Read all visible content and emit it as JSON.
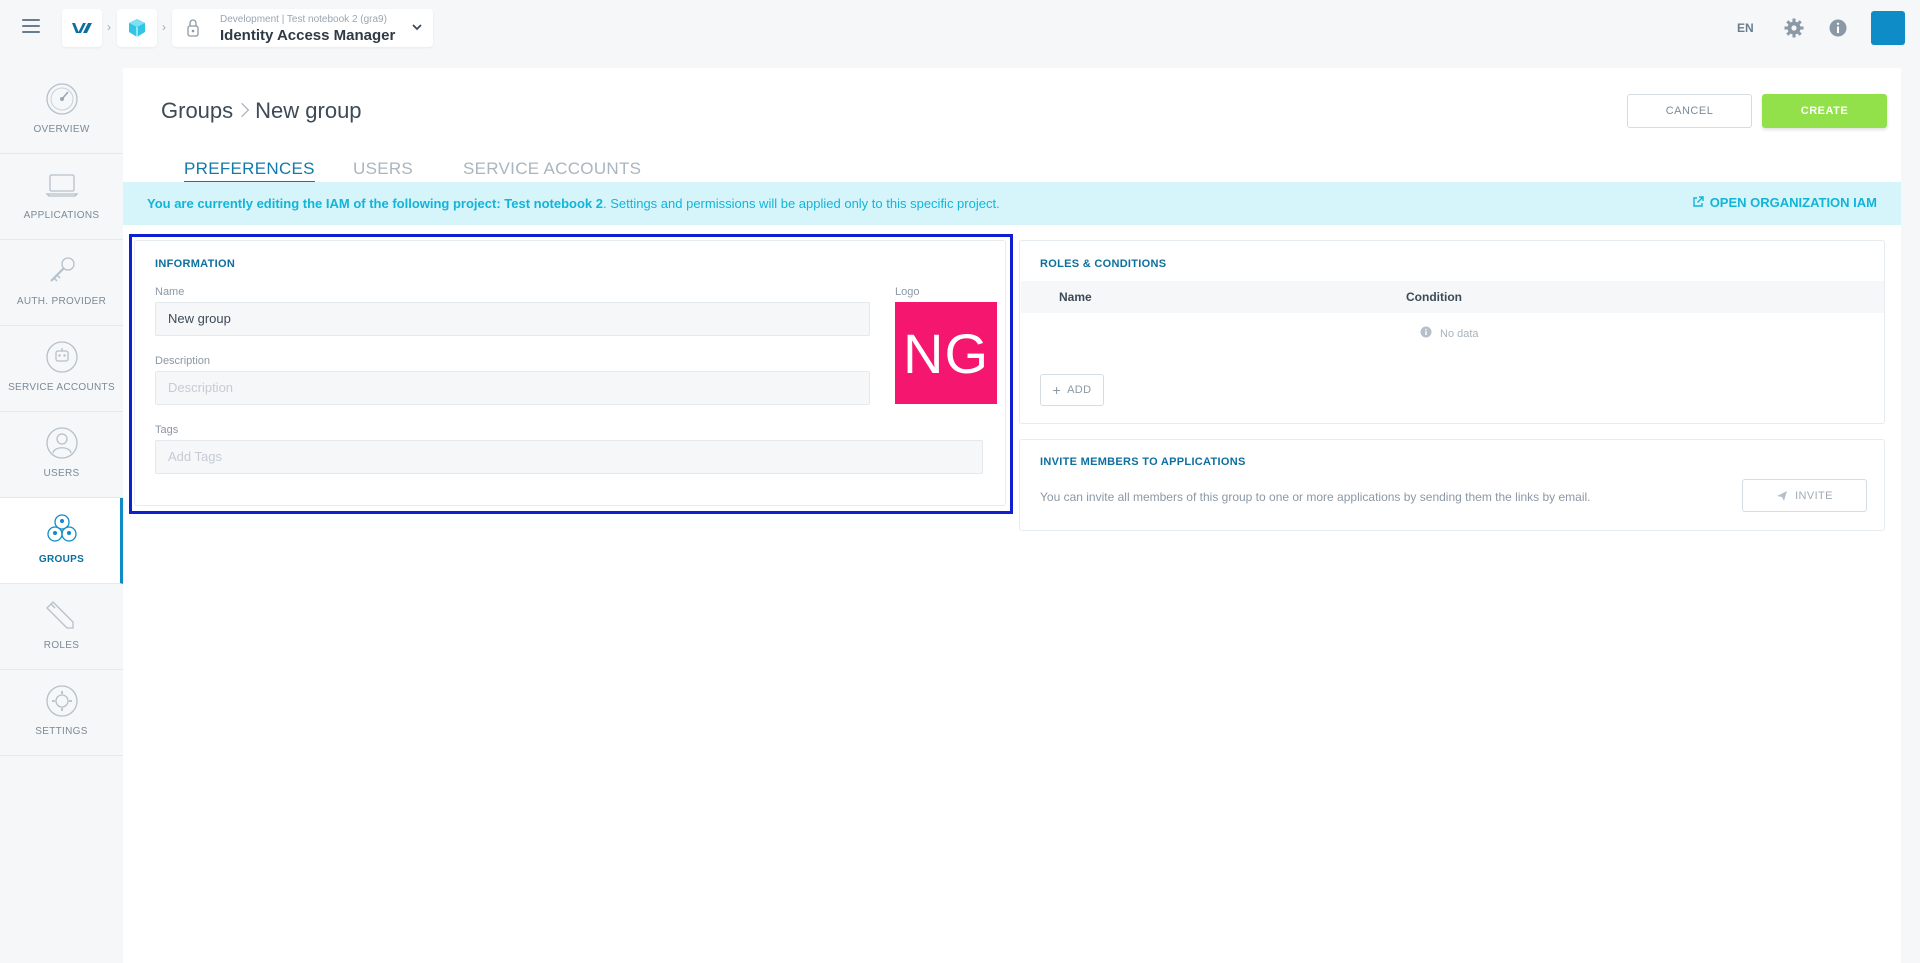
{
  "topbar": {
    "project_path": "Development | Test notebook 2 (gra9)",
    "app_title": "Identity Access Manager",
    "language": "EN",
    "icons": [
      "menu-icon",
      "ovh-logo-icon",
      "cube-icon",
      "hand-lock-icon",
      "chevron-down-icon",
      "gear-icon",
      "info-icon"
    ]
  },
  "sidenav": {
    "items": [
      {
        "label": "OVERVIEW",
        "icon": "gauge-icon",
        "active": false
      },
      {
        "label": "APPLICATIONS",
        "icon": "laptop-icon",
        "active": false
      },
      {
        "label": "AUTH. PROVIDER",
        "icon": "key-icon",
        "active": false
      },
      {
        "label": "SERVICE ACCOUNTS",
        "icon": "robot-icon",
        "active": false
      },
      {
        "label": "USERS",
        "icon": "user-icon",
        "active": false
      },
      {
        "label": "GROUPS",
        "icon": "group-icon",
        "active": true
      },
      {
        "label": "ROLES",
        "icon": "pencil-icon",
        "active": false
      },
      {
        "label": "SETTINGS",
        "icon": "settings-icon",
        "active": false
      }
    ]
  },
  "header": {
    "breadcrumb_parent": "Groups",
    "breadcrumb_current": "New group",
    "cancel_label": "CANCEL",
    "create_label": "CREATE",
    "accent_color": "#92e04a"
  },
  "tabs": [
    {
      "label": "PREFERENCES",
      "active": true
    },
    {
      "label": "USERS",
      "active": false
    },
    {
      "label": "SERVICE ACCOUNTS",
      "active": false
    }
  ],
  "banner": {
    "message_bold": "You are currently editing the IAM of the following project: Test notebook 2",
    "message_rest": ". Settings and permissions will be applied only to this specific project.",
    "link_label": "OPEN ORGANIZATION IAM"
  },
  "information": {
    "title": "INFORMATION",
    "name_label": "Name",
    "name_value": "New group",
    "description_label": "Description",
    "description_placeholder": "Description",
    "tags_label": "Tags",
    "tags_placeholder": "Add Tags",
    "logo_label": "Logo",
    "logo_initials": "NG",
    "logo_color": "#f5166f"
  },
  "roles": {
    "title": "ROLES & CONDITIONS",
    "columns": [
      "Name",
      "Condition"
    ],
    "empty_text": "No data",
    "add_label": "ADD"
  },
  "invite": {
    "title": "INVITE MEMBERS TO APPLICATIONS",
    "description": "You can invite all members of this group to one or more applications by sending them the links by email.",
    "button_label": "INVITE"
  }
}
